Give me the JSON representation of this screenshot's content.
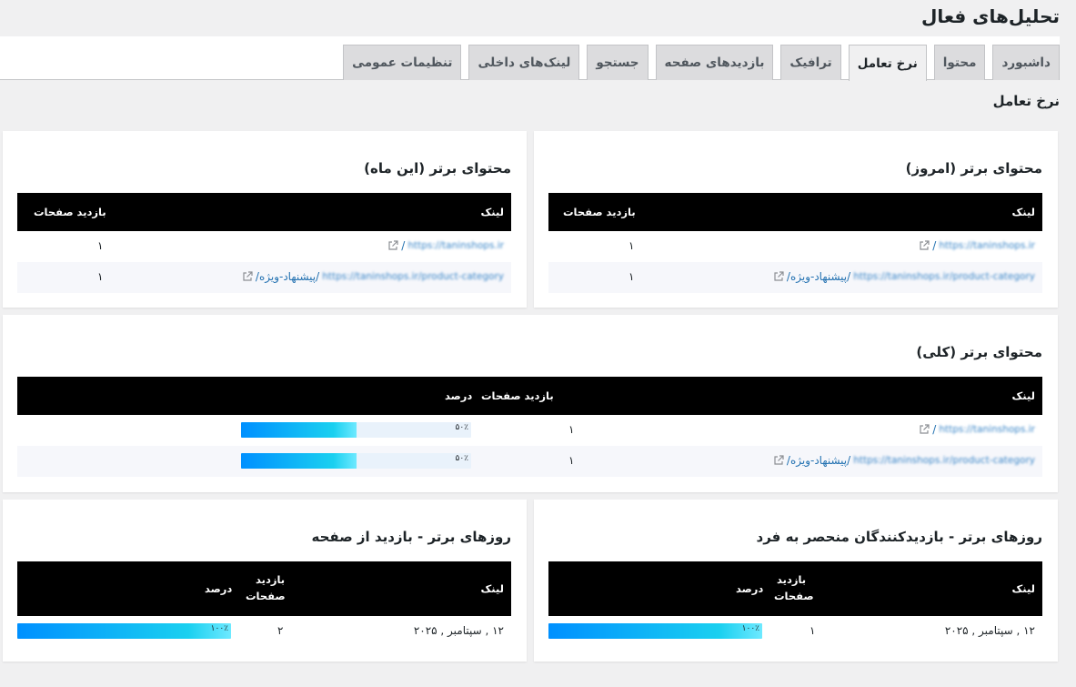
{
  "page": {
    "title": "تحلیل‌های فعال",
    "section_title": "نرخ تعامل"
  },
  "tabs": [
    {
      "label": "داشبورد",
      "active": false
    },
    {
      "label": "محتوا",
      "active": false
    },
    {
      "label": "نرخ تعامل",
      "active": true
    },
    {
      "label": "ترافیک",
      "active": false
    },
    {
      "label": "بازدیدهای صفحه",
      "active": false
    },
    {
      "label": "جستجو",
      "active": false
    },
    {
      "label": "لینک‌های داخلی",
      "active": false
    },
    {
      "label": "تنظیمات عمومی",
      "active": false
    }
  ],
  "top_today": {
    "title": "محتوای برتر (امروز)",
    "col_link": "لینک",
    "col_views": "بازدید صفحات",
    "rows": [
      {
        "url": "https://taninshops.ir",
        "slug": "/",
        "views": "۱"
      },
      {
        "url": "https://taninshops.ir/product-category",
        "slug": "/پیشنهاد-ویژه/",
        "views": "۱"
      }
    ]
  },
  "top_month": {
    "title": "محتوای برتر (این ماه)",
    "col_link": "لینک",
    "col_views": "بازدید صفحات",
    "rows": [
      {
        "url": "https://taninshops.ir",
        "slug": "/",
        "views": "۱"
      },
      {
        "url": "https://taninshops.ir/product-category",
        "slug": "/پیشنهاد-ویژه/",
        "views": "۱"
      }
    ]
  },
  "top_all": {
    "title": "محتوای برتر (کلی)",
    "col_link": "لینک",
    "col_views": "بازدید صفحات",
    "col_percent": "درصد",
    "rows": [
      {
        "url": "https://taninshops.ir",
        "slug": "/",
        "views": "۱",
        "percent_label": "۵۰٪",
        "percent": 0.5
      },
      {
        "url": "https://taninshops.ir/product-category",
        "slug": "/پیشنهاد-ویژه/",
        "views": "۱",
        "percent_label": "۵۰٪",
        "percent": 0.5
      }
    ]
  },
  "days_unique": {
    "title": "روزهای برتر - بازدیدکنندگان منحصر به فرد",
    "col_link": "لینک",
    "col_views_line1": "بازدید",
    "col_views_line2": "صفحات",
    "col_percent": "درصد",
    "rows": [
      {
        "date": "۱۲ , سپتامبر , ۲۰۲۵",
        "views": "۱",
        "percent_label": "۱۰۰٪",
        "percent": 1.0
      }
    ]
  },
  "days_pageviews": {
    "title": "روزهای برتر - بازدید از صفحه",
    "col_link": "لینک",
    "col_views_line1": "بازدید",
    "col_views_line2": "صفحات",
    "col_percent": "درصد",
    "rows": [
      {
        "date": "۱۲ , سپتامبر , ۲۰۲۵",
        "views": "۲",
        "percent_label": "۱۰۰٪",
        "percent": 1.0
      }
    ]
  },
  "colors": {
    "accent_link": "#2271b1",
    "header_bg": "#000000",
    "bar_start": "#0090ff",
    "bar_end": "#6ee9ff"
  }
}
